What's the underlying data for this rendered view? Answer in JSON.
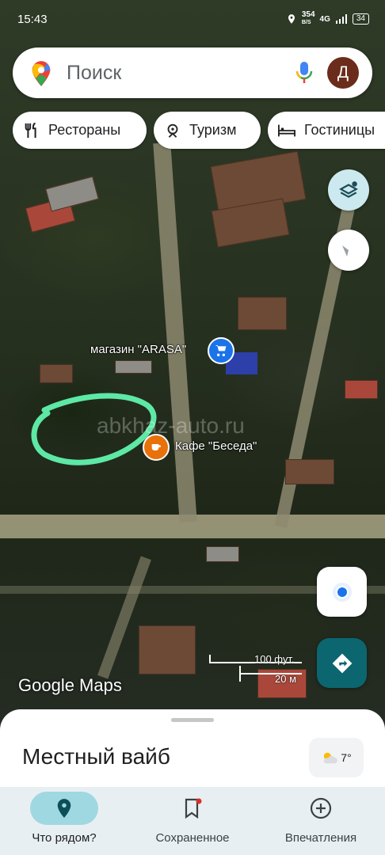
{
  "status_bar": {
    "time": "15:43",
    "net_speed_top": "354",
    "net_speed_bottom": "B/S",
    "network": "4G",
    "battery": "34"
  },
  "search": {
    "placeholder": "Поиск",
    "avatar_letter": "Д"
  },
  "chips": [
    {
      "label": "Рестораны",
      "icon": "restaurant-icon"
    },
    {
      "label": "Туризм",
      "icon": "tourism-icon"
    },
    {
      "label": "Гостиницы",
      "icon": "hotel-icon"
    }
  ],
  "map": {
    "poi_shop": "магазин \"ARASA\"",
    "poi_cafe": "Кафе \"Беседа\"",
    "watermark": "abkhaz-auto.ru",
    "logo": "Google Maps",
    "scale_ft": "100 фут.",
    "scale_m": "20 м"
  },
  "sheet": {
    "title": "Местный вайб",
    "weather_temp": "7°"
  },
  "nav": [
    {
      "label": "Что рядом?",
      "icon": "location-pin-icon",
      "active": true
    },
    {
      "label": "Сохраненное",
      "icon": "bookmark-icon",
      "active": false
    },
    {
      "label": "Впечатления",
      "icon": "add-circle-icon",
      "active": false
    }
  ],
  "colors": {
    "accent": "#006a6a",
    "highlight": "#5ee8a6",
    "shop_poi": "#1a73e8",
    "cafe_poi": "#e8710a"
  }
}
